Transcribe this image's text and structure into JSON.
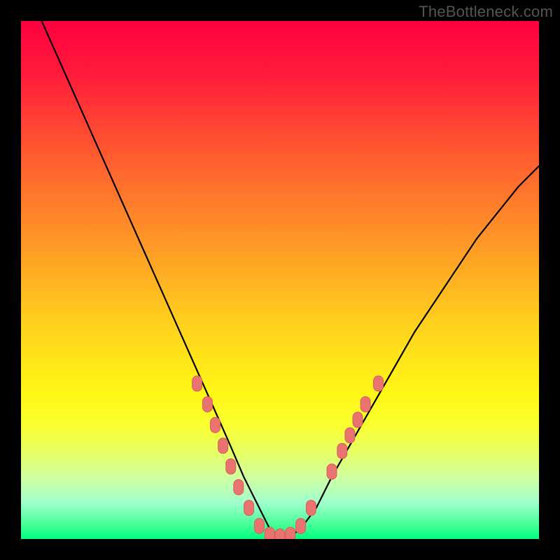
{
  "watermark": "TheBottleneck.com",
  "colors": {
    "frame": "#000000",
    "curve": "#000000",
    "markers_fill": "#e8736f",
    "markers_stroke": "#d85f5a"
  },
  "chart_data": {
    "type": "line",
    "title": "",
    "xlabel": "",
    "ylabel": "",
    "xlim": [
      0,
      100
    ],
    "ylim": [
      0,
      100
    ],
    "grid": false,
    "note": "No axis ticks or numeric labels are rendered; values below are estimates in percent of plot area (x left→right, y bottom→top).",
    "series": [
      {
        "name": "bottleneck-curve",
        "x": [
          0,
          4,
          8,
          12,
          16,
          20,
          24,
          28,
          32,
          36,
          40,
          43,
          46,
          48,
          50,
          52,
          54,
          57,
          60,
          64,
          68,
          72,
          76,
          80,
          84,
          88,
          92,
          96,
          100
        ],
        "y": [
          108,
          100,
          91,
          82,
          73,
          64,
          55,
          46,
          37,
          28,
          19,
          12,
          6,
          2,
          0.5,
          0.5,
          2,
          6,
          12,
          19,
          26,
          33,
          40,
          46,
          52,
          58,
          63,
          68,
          72
        ]
      }
    ],
    "markers": {
      "name": "highlighted-points",
      "shape": "pill",
      "points": [
        {
          "x": 34,
          "y": 30
        },
        {
          "x": 36,
          "y": 26
        },
        {
          "x": 37.5,
          "y": 22
        },
        {
          "x": 39,
          "y": 18
        },
        {
          "x": 40.5,
          "y": 14
        },
        {
          "x": 42,
          "y": 10
        },
        {
          "x": 44,
          "y": 6
        },
        {
          "x": 46,
          "y": 2.5
        },
        {
          "x": 48,
          "y": 0.8
        },
        {
          "x": 50,
          "y": 0.5
        },
        {
          "x": 52,
          "y": 0.8
        },
        {
          "x": 54,
          "y": 2.5
        },
        {
          "x": 56,
          "y": 6
        },
        {
          "x": 60,
          "y": 13
        },
        {
          "x": 62,
          "y": 17
        },
        {
          "x": 63.5,
          "y": 20
        },
        {
          "x": 65,
          "y": 23
        },
        {
          "x": 66.5,
          "y": 26
        },
        {
          "x": 69,
          "y": 30
        }
      ]
    }
  }
}
